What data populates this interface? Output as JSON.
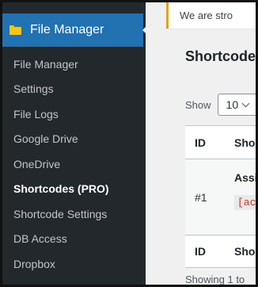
{
  "sidebar": {
    "active_title": "File Manager",
    "items": [
      {
        "label": "File Manager"
      },
      {
        "label": "Settings"
      },
      {
        "label": "File Logs"
      },
      {
        "label": "Google Drive"
      },
      {
        "label": "OneDrive"
      },
      {
        "label": "Shortcodes (PRO)"
      },
      {
        "label": "Shortcode Settings"
      },
      {
        "label": "DB Access"
      },
      {
        "label": "Dropbox"
      }
    ]
  },
  "main": {
    "notice_text": "We are stro",
    "section_title": "Shortcode",
    "show_label": "Show",
    "page_length": "10",
    "table": {
      "headers": [
        "ID",
        "Shor"
      ],
      "row": {
        "id": "#1",
        "name": "Assi",
        "code": "[ac"
      },
      "footers": [
        "ID",
        "Shor"
      ]
    },
    "showing_text": "Showing 1 to"
  },
  "colors": {
    "sidebar_bg": "#23282d",
    "active_bg": "#2271b1",
    "notice_border": "#dba617",
    "code_color": "#c0392b"
  },
  "icons": {
    "menu_icon": "folder-icon",
    "select_icon": "chevron-down-icon"
  }
}
